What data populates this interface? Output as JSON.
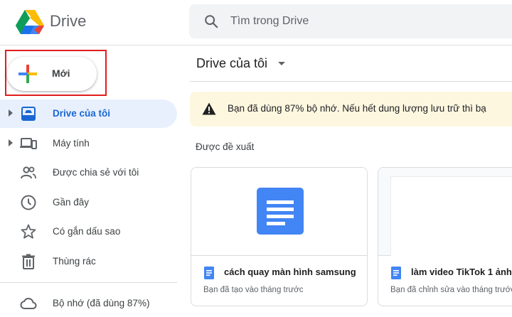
{
  "app": {
    "name": "Drive"
  },
  "search": {
    "placeholder": "Tìm trong Drive"
  },
  "new_button": {
    "label": "Mới"
  },
  "sidebar": {
    "items": [
      {
        "label": "Drive của tôi",
        "icon": "my-drive-icon",
        "active": true,
        "expandable": true
      },
      {
        "label": "Máy tính",
        "icon": "computers-icon",
        "active": false,
        "expandable": true
      },
      {
        "label": "Được chia sẻ với tôi",
        "icon": "shared-people-icon",
        "active": false,
        "expandable": false
      },
      {
        "label": "Gần đây",
        "icon": "clock-icon",
        "active": false,
        "expandable": false
      },
      {
        "label": "Có gắn dấu sao",
        "icon": "star-icon",
        "active": false,
        "expandable": false
      },
      {
        "label": "Thùng rác",
        "icon": "trash-icon",
        "active": false,
        "expandable": false
      }
    ],
    "storage_label": "Bộ nhớ (đã dùng 87%)"
  },
  "main": {
    "title": "Drive của tôi",
    "warning": "Bạn đã dùng 87% bộ nhớ. Nếu hết dung lượng lưu trữ thì bạ",
    "suggested_heading": "Được đề xuất",
    "cards": [
      {
        "name": "cách quay màn hình samsung",
        "subtitle": "Bạn đã tạo vào tháng trước",
        "type": "doc"
      },
      {
        "name": "làm video TikTok 1 ảnh",
        "subtitle": "Bạn đã chỉnh sửa vào tháng trước",
        "type": "doc"
      }
    ]
  },
  "colors": {
    "accent": "#1967d2",
    "active_bg": "#e8f0fe",
    "warning_bg": "#fef7e0",
    "doc_blue": "#4285f4",
    "highlight_border": "#e11d1d"
  }
}
